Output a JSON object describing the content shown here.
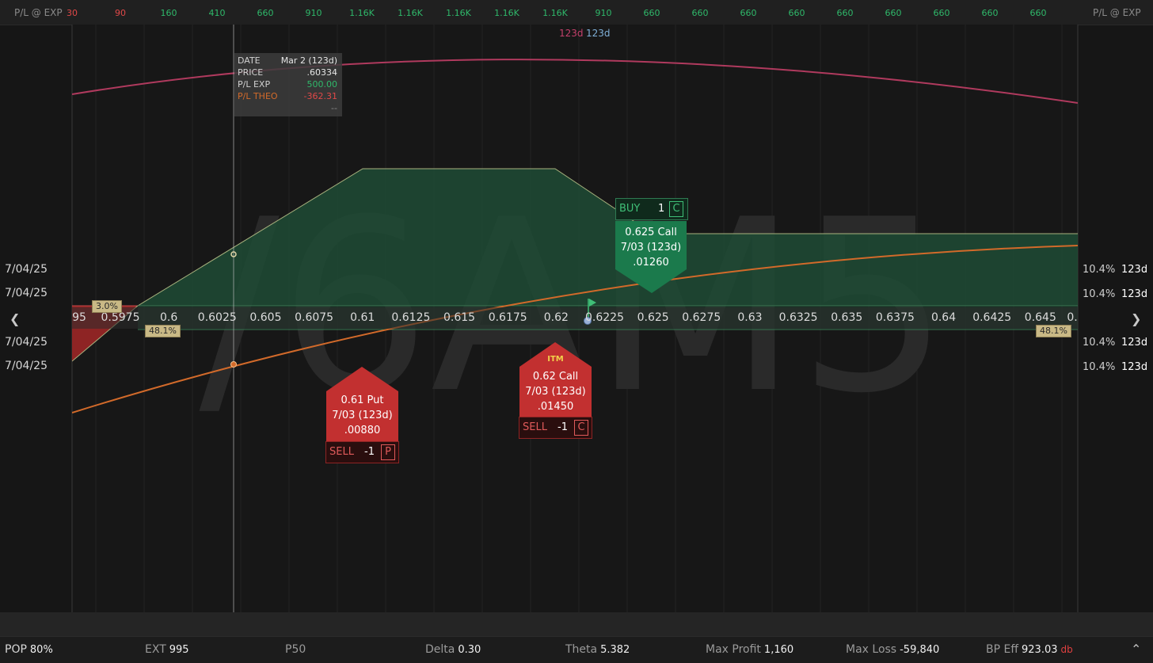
{
  "header": {
    "left_label": "P/L @ EXP",
    "right_label": "P/L @ EXP",
    "values": [
      {
        "text": "30",
        "color": "#e04848"
      },
      {
        "text": "90",
        "color": "#e04848"
      },
      {
        "text": "160",
        "color": "#2fb86a"
      },
      {
        "text": "410",
        "color": "#2fb86a"
      },
      {
        "text": "660",
        "color": "#2fb86a"
      },
      {
        "text": "910",
        "color": "#2fb86a"
      },
      {
        "text": "1.16K",
        "color": "#2fb86a"
      },
      {
        "text": "1.16K",
        "color": "#2fb86a"
      },
      {
        "text": "1.16K",
        "color": "#2fb86a"
      },
      {
        "text": "1.16K",
        "color": "#2fb86a"
      },
      {
        "text": "1.16K",
        "color": "#2fb86a"
      },
      {
        "text": "910",
        "color": "#2fb86a"
      },
      {
        "text": "660",
        "color": "#2fb86a"
      },
      {
        "text": "660",
        "color": "#2fb86a"
      },
      {
        "text": "660",
        "color": "#2fb86a"
      },
      {
        "text": "660",
        "color": "#2fb86a"
      },
      {
        "text": "660",
        "color": "#2fb86a"
      },
      {
        "text": "660",
        "color": "#2fb86a"
      },
      {
        "text": "660",
        "color": "#2fb86a"
      },
      {
        "text": "660",
        "color": "#2fb86a"
      },
      {
        "text": "660",
        "color": "#2fb86a"
      }
    ]
  },
  "tooltip": {
    "date_label": "DATE",
    "date_value": "Mar 2 (123d)",
    "price_label": "PRICE",
    "price_value": ".60334",
    "plexp_label": "P/L EXP",
    "plexp_value": "500.00",
    "pltheo_label": "P/L THEO",
    "pltheo_value": "-362.31",
    "extra_value": "--"
  },
  "curve_labels": {
    "a": "123d",
    "b": "123d"
  },
  "watermark": "/6AM5",
  "left_dates": [
    "7/04/25",
    "7/04/25",
    "7/04/25",
    "7/04/25"
  ],
  "right_rows": [
    {
      "pct": "10.4%",
      "days": "123d"
    },
    {
      "pct": "10.4%",
      "days": "123d"
    },
    {
      "pct": "10.4%",
      "days": "123d"
    },
    {
      "pct": "10.4%",
      "days": "123d"
    }
  ],
  "price_axis": [
    "95",
    "0.5975",
    "0.6",
    "0.6025",
    "0.605",
    "0.6075",
    "0.61",
    "0.6125",
    "0.615",
    "0.6175",
    "0.62",
    "0.6225",
    "0.625",
    "0.6275",
    "0.63",
    "0.6325",
    "0.635",
    "0.6375",
    "0.64",
    "0.6425",
    "0.645",
    "0."
  ],
  "badges": {
    "top_left": "3.0%",
    "bottom_left": "48.1%",
    "bottom_right": "48.1%"
  },
  "legs": {
    "buy_call": {
      "action": "BUY",
      "qty": "1",
      "type": "C",
      "strike": "0.625 Call",
      "expiry": "7/03 (123d)",
      "price": ".01260"
    },
    "sell_put": {
      "action": "SELL",
      "qty": "-1",
      "type": "P",
      "strike": "0.61 Put",
      "expiry": "7/03 (123d)",
      "price": ".00880"
    },
    "sell_call": {
      "tag": "ITM",
      "action": "SELL",
      "qty": "-1",
      "type": "C",
      "strike": "0.62 Call",
      "expiry": "7/03 (123d)",
      "price": ".01450"
    }
  },
  "footer": {
    "pop_label": "POP",
    "pop_value": "80%",
    "ext_label": "EXT",
    "ext_value": "995",
    "p50_label": "P50",
    "delta_label": "Delta",
    "delta_value": "0.30",
    "theta_label": "Theta",
    "theta_value": "5.382",
    "maxprofit_label": "Max Profit",
    "maxprofit_value": "1,160",
    "maxloss_label": "Max Loss",
    "maxloss_value": "-59,840",
    "bpeff_label": "BP Eff",
    "bpeff_value": "923.03",
    "bpeff_unit": "db"
  },
  "colors": {
    "profit": "#1f6b45",
    "loss": "#8e2424",
    "theo": "#d26a2a",
    "theo_far": "#b03a5e"
  }
}
